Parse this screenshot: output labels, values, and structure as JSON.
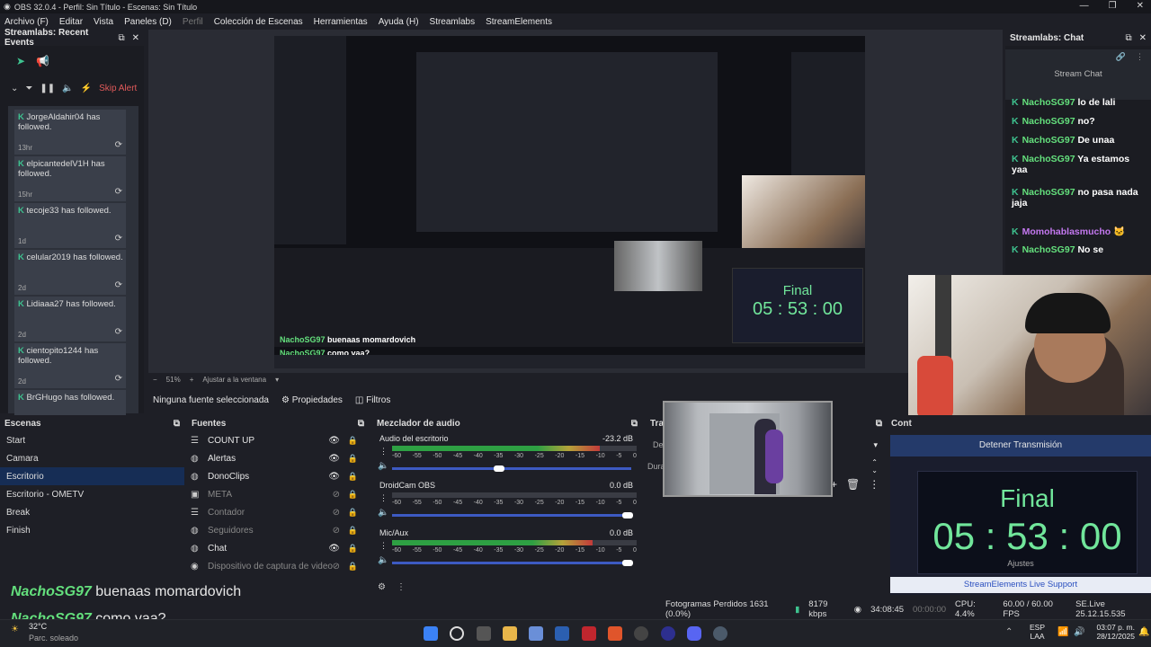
{
  "window": {
    "title": "OBS 32.0.4 - Perfil: Sin Título - Escenas: Sin Título"
  },
  "menu": [
    "Archivo (F)",
    "Editar",
    "Vista",
    "Paneles (D)",
    "Perfil",
    "Colección de Escenas",
    "Herramientas",
    "Ayuda (H)",
    "Streamlabs",
    "StreamElements"
  ],
  "recent_events": {
    "title": "Streamlabs: Recent Events",
    "skip_label": "Skip Alert",
    "items": [
      {
        "name": "JorgeAldahir04",
        "action": "has followed.",
        "time": "13hr"
      },
      {
        "name": "elpicantedelV1H",
        "action": "has followed.",
        "time": "15hr"
      },
      {
        "name": "tecoje33",
        "action": "has followed.",
        "time": "1d"
      },
      {
        "name": "celular2019",
        "action": "has followed.",
        "time": "2d"
      },
      {
        "name": "Lidiaaa27",
        "action": "has followed.",
        "time": "2d"
      },
      {
        "name": "cientopito1244",
        "action": "has followed.",
        "time": "2d"
      },
      {
        "name": "BrGHugo",
        "action": "has followed.",
        "time": ""
      }
    ]
  },
  "chat": {
    "title": "Streamlabs: Chat",
    "header": "Stream Chat",
    "messages": [
      {
        "user": "NachoSG97",
        "text": "lo de lali",
        "color": "#64e07d"
      },
      {
        "user": "NachoSG97",
        "text": "no?",
        "color": "#64e07d"
      },
      {
        "user": "NachoSG97",
        "text": "De unaa",
        "color": "#64e07d"
      },
      {
        "user": "NachoSG97",
        "text": "Ya estamos yaa",
        "color": "#64e07d"
      },
      {
        "user": "NachoSG97",
        "text": "no pasa nada jaja",
        "color": "#64e07d"
      },
      {
        "user": "Momohablasmucho",
        "text": "🐱",
        "color": "#c478f0"
      },
      {
        "user": "NachoSG97",
        "text": "No se",
        "color": "#64e07d"
      }
    ]
  },
  "preview": {
    "zoom": "51%",
    "fit_label": "Ajustar a la ventana"
  },
  "source_status": {
    "none_selected": "Ninguna fuente seleccionada",
    "properties": "Propiedades",
    "filters": "Filtros"
  },
  "scenes": {
    "title": "Escenas",
    "items": [
      "Start",
      "Camara",
      "Escritorio",
      "Escritorio - OMETV",
      "Break",
      "Finish"
    ],
    "selected": 2
  },
  "sources": {
    "title": "Fuentes",
    "items": [
      {
        "name": "COUNT UP",
        "icon": "☰",
        "visible": true
      },
      {
        "name": "Alertas",
        "icon": "◍",
        "visible": true
      },
      {
        "name": "DonoClips",
        "icon": "◍",
        "visible": true
      },
      {
        "name": "META",
        "icon": "▣",
        "visible": false
      },
      {
        "name": "Contador",
        "icon": "☰",
        "visible": false
      },
      {
        "name": "Seguidores",
        "icon": "◍",
        "visible": false
      },
      {
        "name": "Chat",
        "icon": "◍",
        "visible": true
      },
      {
        "name": "Dispositivo de captura de video",
        "icon": "◉",
        "visible": false
      }
    ]
  },
  "mixer": {
    "title": "Mezclador de audio",
    "channels": [
      {
        "name": "Audio del escritorio",
        "db": "-23.2 dB",
        "level": 0.85,
        "volume": 0.44,
        "muted": false
      },
      {
        "name": "DroidCam OBS",
        "db": "0.0 dB",
        "level": 0.0,
        "volume": 1.0,
        "muted": true
      },
      {
        "name": "Mic/Aux",
        "db": "0.0 dB",
        "level": 0.82,
        "volume": 1.0,
        "muted": false
      }
    ],
    "scale": [
      "-60",
      "-55",
      "-50",
      "-45",
      "-40",
      "-35",
      "-30",
      "-25",
      "-20",
      "-15",
      "-10",
      "-5",
      "0"
    ]
  },
  "transitions": {
    "title_partial": "Trai",
    "fade_label": "Des",
    "duration_label": "Dura"
  },
  "controls": {
    "title_partial": "Cont",
    "stop_stream": "Detener Transmisión",
    "settings": "Ajustes",
    "support": "StreamElements Live Support"
  },
  "final_timer": {
    "label": "Final",
    "time": "05 : 53 : 00"
  },
  "overlay_chat": [
    {
      "user": "NachoSG97",
      "text": "buenaas momardovich"
    },
    {
      "user": "NachoSG97",
      "text": "como vaa?"
    }
  ],
  "status": {
    "dropped": "Fotogramas Perdidos 1631 (0.0%)",
    "kbps": "8179 kbps",
    "live_time": "34:08:45",
    "rec_time": "00:00:00",
    "cpu": "CPU: 4.4%",
    "fps": "60.00 / 60.00 FPS",
    "version": "SE.Live 25.12.15.535"
  },
  "taskbar": {
    "weather_temp": "32°C",
    "weather_desc": "Parc. soleado",
    "lang": "ESP",
    "lang2": "LAA",
    "time": "03:07 p. m.",
    "date": "28/12/2025"
  }
}
